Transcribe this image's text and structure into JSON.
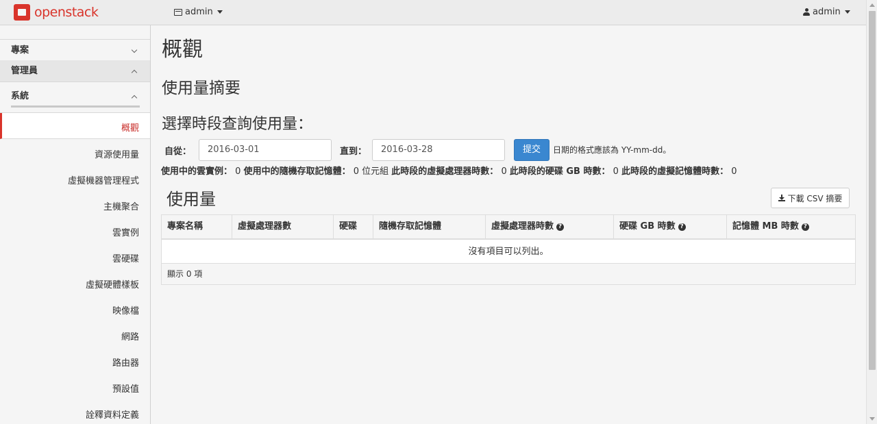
{
  "header": {
    "logo_text": "openstack",
    "project_label": "admin",
    "user_label": "admin"
  },
  "sidebar": {
    "project_section": "專案",
    "admin_section": "管理員",
    "system_section": "系統",
    "active_item": "概觀",
    "items": [
      "資源使用量",
      "虛擬機器管理程式",
      "主機聚合",
      "雲實例",
      "雲硬碟",
      "虛擬硬體樣板",
      "映像檔",
      "網路",
      "路由器",
      "預設值",
      "詮釋資料定義"
    ]
  },
  "main": {
    "title": "概觀",
    "usage_summary": "使用量摘要",
    "select_period": "選擇時段查詢使用量：",
    "from_label": "自從：",
    "from_value": "2016-03-01",
    "to_label": "直到：",
    "to_value": "2016-03-28",
    "submit_label": "提交",
    "date_hint": "日期的格式應該為 YY-mm-dd。",
    "stats": {
      "active_instances_label": "使用中的雲實例：",
      "active_instances_value": "0",
      "active_ram_label": "使用中的隨機存取記憶體：",
      "active_ram_value": "0 位元組",
      "vcpu_hours_label": "此時段的虛擬處理器時數：",
      "vcpu_hours_value": "0",
      "disk_hours_label": "此時段的硬碟 GB 時數：",
      "disk_hours_value": "0",
      "ram_hours_label": "此時段的虛擬記憶體時數：",
      "ram_hours_value": "0"
    },
    "usage_heading": "使用量",
    "csv_button": "下載 CSV 摘要",
    "table": {
      "columns": [
        "專案名稱",
        "虛擬處理器數",
        "硬碟",
        "隨機存取記憶體",
        "虛擬處理器時數",
        "硬碟 GB 時數",
        "記憶體 MB 時數"
      ],
      "empty_message": "沒有項目可以列出。",
      "footer": "顯示 0 項"
    }
  },
  "colors": {
    "brand_red": "#d9342b",
    "primary_blue": "#3a87d0"
  }
}
